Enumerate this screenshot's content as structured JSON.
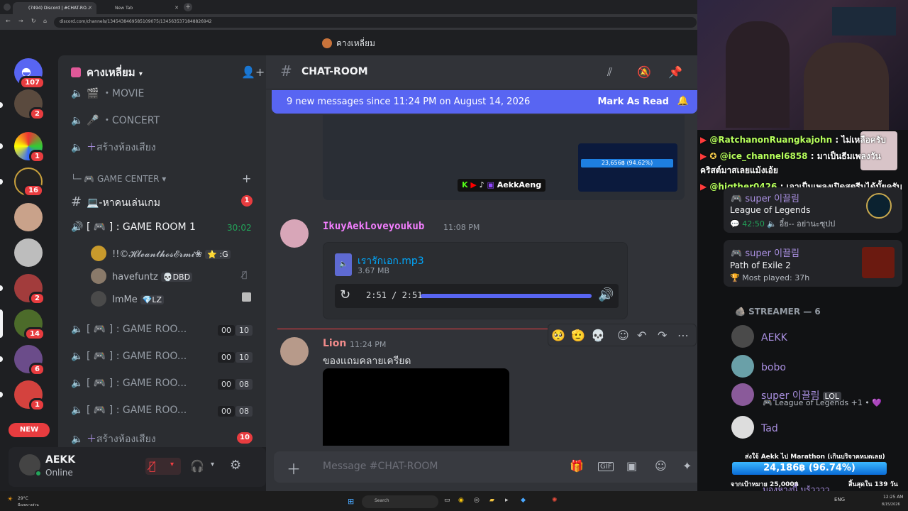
{
  "browser": {
    "tabs": [
      {
        "title": "(7494) Discord | #CHAT-RO..."
      },
      {
        "title": "New Tab"
      }
    ],
    "url": "discord.com/channels/1345438469585109075/1345635371848826942"
  },
  "server_title": "คางเหลี่ยม",
  "guilds": [
    {
      "badge": "107"
    },
    {
      "badge": "2"
    },
    {
      "badge": "1"
    },
    {
      "badge": "16"
    },
    {
      "badge": ""
    },
    {
      "badge": ""
    },
    {
      "badge": "2"
    },
    {
      "badge": "14"
    },
    {
      "badge": "6"
    },
    {
      "badge": "1"
    }
  ],
  "new_badge": "NEW",
  "sidebar": {
    "server_name": "คางเหลี่ยม",
    "channels": [
      {
        "icon": "speaker-icon",
        "label": "MOVIE",
        "prefix": "🎬 ・"
      },
      {
        "icon": "speaker-icon",
        "label": "CONCERT",
        "prefix": "🎤 ・"
      },
      {
        "icon": "speaker-icon",
        "label": "สร้างห้องเสียง",
        "prefix": "＋"
      }
    ],
    "category": "🎮 GAME CENTER",
    "text_channel": {
      "label": "💻-หาคนเล่นเกม",
      "badge": "1"
    },
    "game_room_1": {
      "label": "[ 🎮 ] : GAME ROOM 1",
      "timer": "30:02"
    },
    "voice_users": [
      {
        "name": "!!©𝓗𝓵𝓮𝓪𝓷𝓽𝓱𝓸𝓼𝓔𝓻𝓶𝓲❀",
        "tag": "⭐ ꞉G"
      },
      {
        "name": "havefuntz",
        "tag": "💀DBD"
      },
      {
        "name": "ImMe",
        "tag": "💎LZ"
      }
    ],
    "game_rooms": [
      {
        "label": "[ 🎮 ] : GAME ROO...",
        "c1": "00",
        "c2": "10"
      },
      {
        "label": "[ 🎮 ] : GAME ROO...",
        "c1": "00",
        "c2": "10"
      },
      {
        "label": "[ 🎮 ] : GAME ROO...",
        "c1": "00",
        "c2": "08"
      },
      {
        "label": "[ 🎮 ] : GAME ROO...",
        "c1": "00",
        "c2": "08"
      }
    ],
    "create_voice": {
      "label": "สร้างห้องเสียง",
      "badge": "10"
    }
  },
  "user_panel": {
    "name": "AEKK",
    "status": "Online"
  },
  "chat": {
    "channel_name": "CHAT-ROOM",
    "new_messages": "9 new messages since 11:24 PM on August 14, 2026",
    "mark_as_read": "Mark As Read",
    "stream_overlay": {
      "amount": "23,656฿ (94.62%)",
      "name": "AekkAeng"
    },
    "messages": [
      {
        "author": "IkuyAekLoveyoukub",
        "time": "11:08 PM",
        "file_name": "เรารักเอก.mp3",
        "file_size": "3.67 MB",
        "audio_time": "2:51 / 2:51",
        "audio_progress": 1.0
      },
      {
        "author": "Lion",
        "time": "11:24 PM",
        "text": "ของแถมคลายเครียด"
      }
    ],
    "input_placeholder": "Message #CHAT-ROOM"
  },
  "stream": {
    "chat_lines": [
      {
        "user": "@RatchanonRuangkajohn",
        "text": ": ไม่เหลือครับ"
      },
      {
        "user": "@ice_channel6858",
        "text": ": มาเป็นธีมเพลงวัน"
      },
      {
        "user": "",
        "text": "คริสต์มาสเลยแม้งเอ้ย"
      },
      {
        "user": "@higther0426",
        "text": ": เอาเป็นเพลงเปิดสตรีมได้มั้ยครับ"
      }
    ],
    "activities": [
      {
        "user": "super 이끌림",
        "game": "League of Legends",
        "time": "42:50",
        "sub": "อี๋ย-- อย่านะซุปป"
      },
      {
        "user": "super 이끌림",
        "game": "Path of Exile 2",
        "sub": "Most played: 37h"
      }
    ],
    "streamer_header": "STREAMER — 6",
    "members": [
      {
        "name": "AEKK",
        "color": "#a98fe0"
      },
      {
        "name": "bobo",
        "color": "#a98fe0"
      },
      {
        "name": "super 이끌림",
        "color": "#a98fe0",
        "tag": "LOL",
        "sub": "League of Legends +1 •"
      },
      {
        "name": "Tad",
        "color": "#a98fe0"
      }
    ],
    "donation": {
      "title": "ส่งใจ้ Aekk ไป Marathon (เกินบริจาคหมดเลย)",
      "amount": "24,186฿ (96.74%)",
      "goal": "จากเป้าหมาย 25,000฿",
      "days": "สิ้นสุดใน 139 วัน",
      "peek": "มองหางนี้ บรู้วววว"
    }
  },
  "taskbar": {
    "weather": "29°C",
    "weather_sub": "มีเมฆบางส่วน",
    "search": "Search",
    "lang": "ENG",
    "time": "12:25 AM",
    "date": "8/15/2026"
  },
  "colors": {
    "accent": "#5865f2",
    "danger": "#e83c3f",
    "online": "#23a55a"
  }
}
